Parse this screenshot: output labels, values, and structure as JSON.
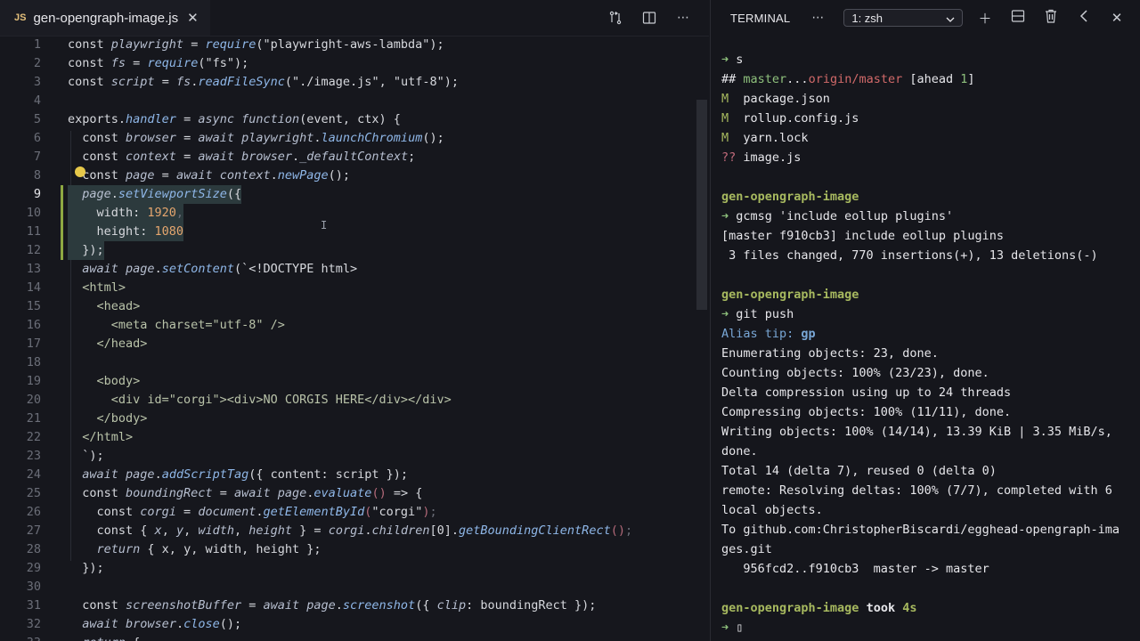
{
  "editor": {
    "tab": {
      "badge": "JS",
      "filename": "gen-opengraph-image.js"
    },
    "lines": [
      {
        "n": "1",
        "segs": [
          [
            "k",
            "const "
          ],
          [
            "i",
            "playwright"
          ],
          [
            "k",
            " = "
          ],
          [
            "f",
            "require"
          ],
          [
            "k",
            "(\"playwright-aws-lambda\");"
          ]
        ]
      },
      {
        "n": "2",
        "segs": [
          [
            "k",
            "const "
          ],
          [
            "i",
            "fs"
          ],
          [
            "k",
            " = "
          ],
          [
            "f",
            "require"
          ],
          [
            "k",
            "(\"fs\");"
          ]
        ]
      },
      {
        "n": "3",
        "segs": [
          [
            "k",
            "const "
          ],
          [
            "i",
            "script"
          ],
          [
            "k",
            " = "
          ],
          [
            "i",
            "fs"
          ],
          [
            "k",
            "."
          ],
          [
            "f",
            "readFileSync"
          ],
          [
            "k",
            "(\"./image.js\", \"utf-8\");"
          ]
        ]
      },
      {
        "n": "4",
        "segs": []
      },
      {
        "n": "5",
        "segs": [
          [
            "k",
            "exports."
          ],
          [
            "f",
            "handler"
          ],
          [
            "k",
            " = "
          ],
          [
            "i",
            "async"
          ],
          [
            "k",
            " "
          ],
          [
            "i",
            "function"
          ],
          [
            "k",
            "(event, ctx) {"
          ]
        ]
      },
      {
        "n": "6",
        "segs": [
          [
            "k",
            "  const "
          ],
          [
            "i",
            "browser"
          ],
          [
            "k",
            " = "
          ],
          [
            "i",
            "await"
          ],
          [
            "k",
            " "
          ],
          [
            "i",
            "playwright"
          ],
          [
            "k",
            "."
          ],
          [
            "f",
            "launchChromium"
          ],
          [
            "k",
            "();"
          ]
        ]
      },
      {
        "n": "7",
        "segs": [
          [
            "k",
            "  const "
          ],
          [
            "i",
            "context"
          ],
          [
            "k",
            " = "
          ],
          [
            "i",
            "await"
          ],
          [
            "k",
            " "
          ],
          [
            "i",
            "browser"
          ],
          [
            "k",
            "."
          ],
          [
            "i",
            "_defaultContext"
          ],
          [
            "k",
            ";"
          ]
        ]
      },
      {
        "n": "8",
        "segs": [
          [
            "k",
            "  const "
          ],
          [
            "i",
            "page"
          ],
          [
            "k",
            " = "
          ],
          [
            "i",
            "await"
          ],
          [
            "k",
            " "
          ],
          [
            "i",
            "context"
          ],
          [
            "k",
            "."
          ],
          [
            "f",
            "newPage"
          ],
          [
            "k",
            "();"
          ]
        ]
      },
      {
        "n": "9",
        "segs": [
          [
            "k",
            "  "
          ],
          [
            "i",
            "page"
          ],
          [
            "k",
            "."
          ],
          [
            "f",
            "setViewportSize"
          ],
          [
            "k",
            "({"
          ]
        ]
      },
      {
        "n": "10",
        "segs": [
          [
            "k",
            "    width: "
          ],
          [
            "n",
            "1920"
          ],
          [
            "dim",
            ","
          ]
        ]
      },
      {
        "n": "11",
        "segs": [
          [
            "k",
            "    height: "
          ],
          [
            "n",
            "1080"
          ]
        ]
      },
      {
        "n": "12",
        "segs": [
          [
            "k",
            "  });"
          ]
        ]
      },
      {
        "n": "13",
        "segs": [
          [
            "k",
            "  "
          ],
          [
            "i",
            "await"
          ],
          [
            "k",
            " "
          ],
          [
            "i",
            "page"
          ],
          [
            "k",
            "."
          ],
          [
            "f",
            "setContent"
          ],
          [
            "k",
            "(`<!DOCTYPE html>"
          ]
        ]
      },
      {
        "n": "14",
        "segs": [
          [
            "t",
            "  <html>"
          ]
        ]
      },
      {
        "n": "15",
        "segs": [
          [
            "t",
            "    <head>"
          ]
        ]
      },
      {
        "n": "16",
        "segs": [
          [
            "t",
            "      <meta charset=\"utf-8\" />"
          ]
        ]
      },
      {
        "n": "17",
        "segs": [
          [
            "t",
            "    </head>"
          ]
        ]
      },
      {
        "n": "18",
        "segs": []
      },
      {
        "n": "19",
        "segs": [
          [
            "t",
            "    <body>"
          ]
        ]
      },
      {
        "n": "20",
        "segs": [
          [
            "t",
            "      <div id=\"corgi\"><div>NO CORGIS HERE</div></div>"
          ]
        ]
      },
      {
        "n": "21",
        "segs": [
          [
            "t",
            "    </body>"
          ]
        ]
      },
      {
        "n": "22",
        "segs": [
          [
            "t",
            "  </html>"
          ]
        ]
      },
      {
        "n": "23",
        "segs": [
          [
            "k",
            "  `);"
          ]
        ]
      },
      {
        "n": "24",
        "segs": [
          [
            "k",
            "  "
          ],
          [
            "i",
            "await"
          ],
          [
            "k",
            " "
          ],
          [
            "i",
            "page"
          ],
          [
            "k",
            "."
          ],
          [
            "f",
            "addScriptTag"
          ],
          [
            "k",
            "({ content: script });"
          ]
        ]
      },
      {
        "n": "25",
        "segs": [
          [
            "k",
            "  const "
          ],
          [
            "i",
            "boundingRect"
          ],
          [
            "k",
            " = "
          ],
          [
            "i",
            "await"
          ],
          [
            "k",
            " "
          ],
          [
            "i",
            "page"
          ],
          [
            "k",
            "."
          ],
          [
            "f",
            "evaluate"
          ],
          [
            "pink",
            "()"
          ],
          [
            "k",
            " => {"
          ]
        ]
      },
      {
        "n": "26",
        "segs": [
          [
            "k",
            "    const "
          ],
          [
            "i",
            "corgi"
          ],
          [
            "k",
            " = "
          ],
          [
            "i",
            "document"
          ],
          [
            "k",
            "."
          ],
          [
            "f",
            "getElementById"
          ],
          [
            "pink",
            "("
          ],
          [
            "k",
            "\"corgi\""
          ],
          [
            "pink",
            ")"
          ],
          [
            "dim",
            ";"
          ]
        ]
      },
      {
        "n": "27",
        "segs": [
          [
            "k",
            "    const { "
          ],
          [
            "i",
            "x"
          ],
          [
            "k",
            ", "
          ],
          [
            "i",
            "y"
          ],
          [
            "k",
            ", "
          ],
          [
            "i",
            "width"
          ],
          [
            "k",
            ", "
          ],
          [
            "i",
            "height"
          ],
          [
            "k",
            " } = "
          ],
          [
            "i",
            "corgi"
          ],
          [
            "k",
            "."
          ],
          [
            "i",
            "children"
          ],
          [
            "k",
            "[0]."
          ],
          [
            "f",
            "getBoundingClientRect"
          ],
          [
            "pink",
            "()"
          ],
          [
            "dim",
            ";"
          ]
        ]
      },
      {
        "n": "28",
        "segs": [
          [
            "k",
            "    "
          ],
          [
            "i",
            "return"
          ],
          [
            "k",
            " { x, y, width, height };"
          ]
        ]
      },
      {
        "n": "29",
        "segs": [
          [
            "k",
            "  });"
          ]
        ]
      },
      {
        "n": "30",
        "segs": []
      },
      {
        "n": "31",
        "segs": [
          [
            "k",
            "  const "
          ],
          [
            "i",
            "screenshotBuffer"
          ],
          [
            "k",
            " = "
          ],
          [
            "i",
            "await"
          ],
          [
            "k",
            " "
          ],
          [
            "i",
            "page"
          ],
          [
            "k",
            "."
          ],
          [
            "f",
            "screenshot"
          ],
          [
            "k",
            "({ "
          ],
          [
            "i",
            "clip"
          ],
          [
            "k",
            ": boundingRect });"
          ]
        ]
      },
      {
        "n": "32",
        "segs": [
          [
            "k",
            "  "
          ],
          [
            "i",
            "await"
          ],
          [
            "k",
            " "
          ],
          [
            "i",
            "browser"
          ],
          [
            "k",
            "."
          ],
          [
            "f",
            "close"
          ],
          [
            "k",
            "();"
          ]
        ]
      },
      {
        "n": "33",
        "segs": [
          [
            "k",
            "  "
          ],
          [
            "i",
            "return"
          ],
          [
            "k",
            " {"
          ]
        ]
      }
    ]
  },
  "terminal": {
    "title": "TERMINAL",
    "shell": "1: zsh",
    "lines": [
      [
        [
          "green",
          "➜ "
        ],
        [
          "white",
          "s"
        ]
      ],
      [
        [
          "white",
          "## "
        ],
        [
          "green",
          "master"
        ],
        [
          "white",
          "..."
        ],
        [
          "red",
          "origin/master"
        ],
        [
          "white",
          " [ahead "
        ],
        [
          "green",
          "1"
        ],
        [
          "white",
          "]"
        ]
      ],
      [
        [
          "olive",
          "M  "
        ],
        [
          "white",
          "package.json"
        ]
      ],
      [
        [
          "olive",
          "M  "
        ],
        [
          "white",
          "rollup.config.js"
        ]
      ],
      [
        [
          "olive",
          "M  "
        ],
        [
          "white",
          "yarn.lock"
        ]
      ],
      [
        [
          "pinkq",
          "?? "
        ],
        [
          "white",
          "image.js"
        ]
      ],
      [],
      [
        [
          "olive bold",
          "gen-opengraph-image"
        ]
      ],
      [
        [
          "green",
          "➜ "
        ],
        [
          "white",
          "gcmsg 'include eollup plugins'"
        ]
      ],
      [
        [
          "white",
          "[master f910cb3] include eollup plugins"
        ]
      ],
      [
        [
          "white",
          " 3 files changed, 770 insertions(+), 13 deletions(-)"
        ]
      ],
      [],
      [
        [
          "olive bold",
          "gen-opengraph-image"
        ]
      ],
      [
        [
          "green",
          "➜ "
        ],
        [
          "white",
          "git push"
        ]
      ],
      [
        [
          "blue",
          "Alias tip: "
        ],
        [
          "blue bold",
          "gp"
        ]
      ],
      [
        [
          "white",
          "Enumerating objects: 23, done."
        ]
      ],
      [
        [
          "white",
          "Counting objects: 100% (23/23), done."
        ]
      ],
      [
        [
          "white",
          "Delta compression using up to 24 threads"
        ]
      ],
      [
        [
          "white",
          "Compressing objects: 100% (11/11), done."
        ]
      ],
      [
        [
          "white",
          "Writing objects: 100% (14/14), 13.39 KiB | 3.35 MiB/s,"
        ]
      ],
      [
        [
          "white",
          "done."
        ]
      ],
      [
        [
          "white",
          "Total 14 (delta 7), reused 0 (delta 0)"
        ]
      ],
      [
        [
          "white",
          "remote: Resolving deltas: 100% (7/7), completed with 6"
        ]
      ],
      [
        [
          "white",
          "local objects."
        ]
      ],
      [
        [
          "white",
          "To github.com:ChristopherBiscardi/egghead-opengraph-ima"
        ]
      ],
      [
        [
          "white",
          "ges.git"
        ]
      ],
      [
        [
          "white",
          "   956fcd2..f910cb3  master -> master"
        ]
      ],
      [],
      [
        [
          "olive bold",
          "gen-opengraph-image"
        ],
        [
          "white bold",
          " took "
        ],
        [
          "olive bold",
          "4s"
        ]
      ],
      [
        [
          "green",
          "➜ "
        ],
        [
          "white",
          "▯"
        ]
      ]
    ]
  }
}
